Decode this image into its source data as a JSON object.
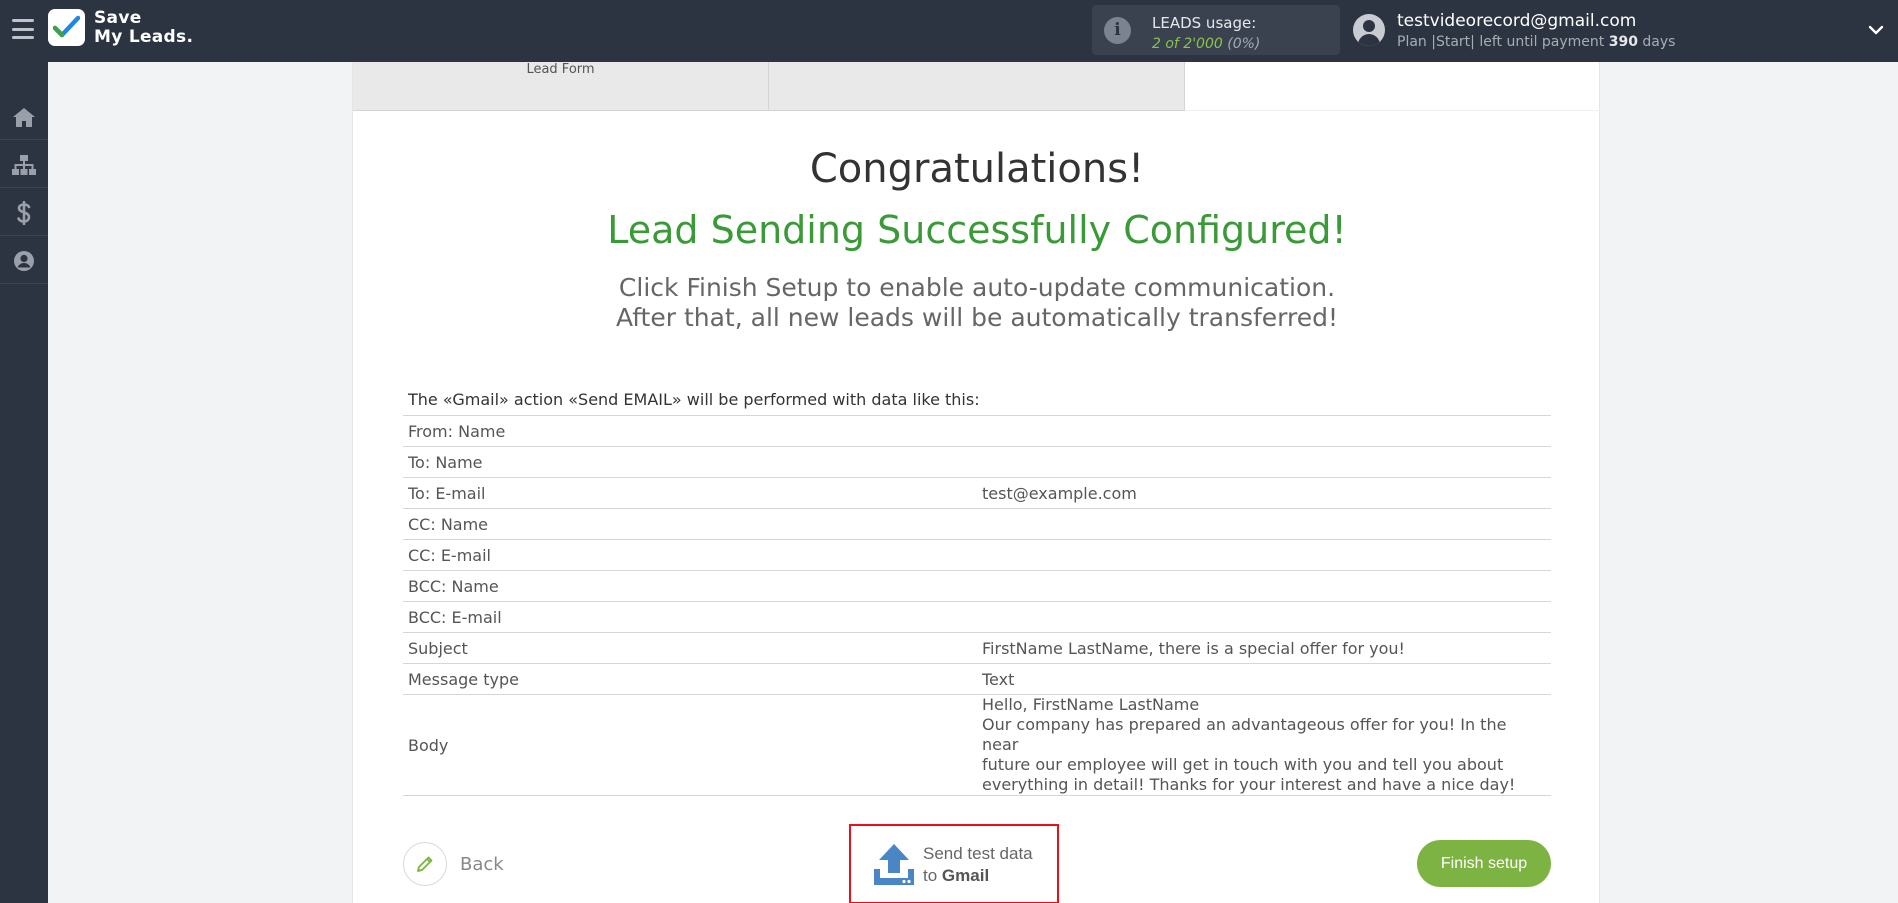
{
  "app": {
    "logo_line1": "Save",
    "logo_line2": "My Leads."
  },
  "usage": {
    "label": "LEADS usage:",
    "used": "2 of 2'000",
    "percent": "(0%)"
  },
  "account": {
    "email": "testvideorecord@gmail.com",
    "plan_prefix": "Plan |Start| left until payment",
    "days_left": "390",
    "days_suffix": "days"
  },
  "sidebar": {
    "items": [
      {
        "name": "home",
        "icon": "home-icon"
      },
      {
        "name": "connections",
        "icon": "sitemap-icon"
      },
      {
        "name": "billing",
        "icon": "dollar-icon"
      },
      {
        "name": "profile",
        "icon": "user-icon"
      }
    ]
  },
  "tabs": {
    "tab1_label": "Lead Form",
    "tab2_label": ""
  },
  "main": {
    "congrats": "Congratulations!",
    "success": "Lead Sending Successfully Configured!",
    "instruction_line1": "Click Finish Setup to enable auto-update communication.",
    "instruction_line2": "After that, all new leads will be automatically transferred!"
  },
  "table": {
    "title": "The «Gmail» action «Send EMAIL» will be performed with data like this:",
    "rows": [
      {
        "key": "From: Name",
        "value": ""
      },
      {
        "key": "To: Name",
        "value": ""
      },
      {
        "key": "To: E-mail",
        "value": "test@example.com"
      },
      {
        "key": "CC: Name",
        "value": ""
      },
      {
        "key": "CC: E-mail",
        "value": ""
      },
      {
        "key": "BCC: Name",
        "value": ""
      },
      {
        "key": "BCC: E-mail",
        "value": ""
      },
      {
        "key": "Subject",
        "value": "FirstName LastName, there is a special offer for you!"
      },
      {
        "key": "Message type",
        "value": "Text"
      },
      {
        "key": "Body",
        "value": "Hello, FirstName LastName\nOur company has prepared an advantageous offer for you! In the near\nfuture our employee will get in touch with you and tell you about\neverything in detail! Thanks for your interest and have a nice day!"
      }
    ]
  },
  "actions": {
    "back_label": "Back",
    "send_line1": "Send test data",
    "send_prefix": "to",
    "send_target": "Gmail",
    "finish_label": "Finish setup"
  },
  "colors": {
    "topbar": "#2c3341",
    "success_green": "#3a9a37",
    "finish_green": "#7cb342",
    "highlight_red": "#e8111a"
  }
}
